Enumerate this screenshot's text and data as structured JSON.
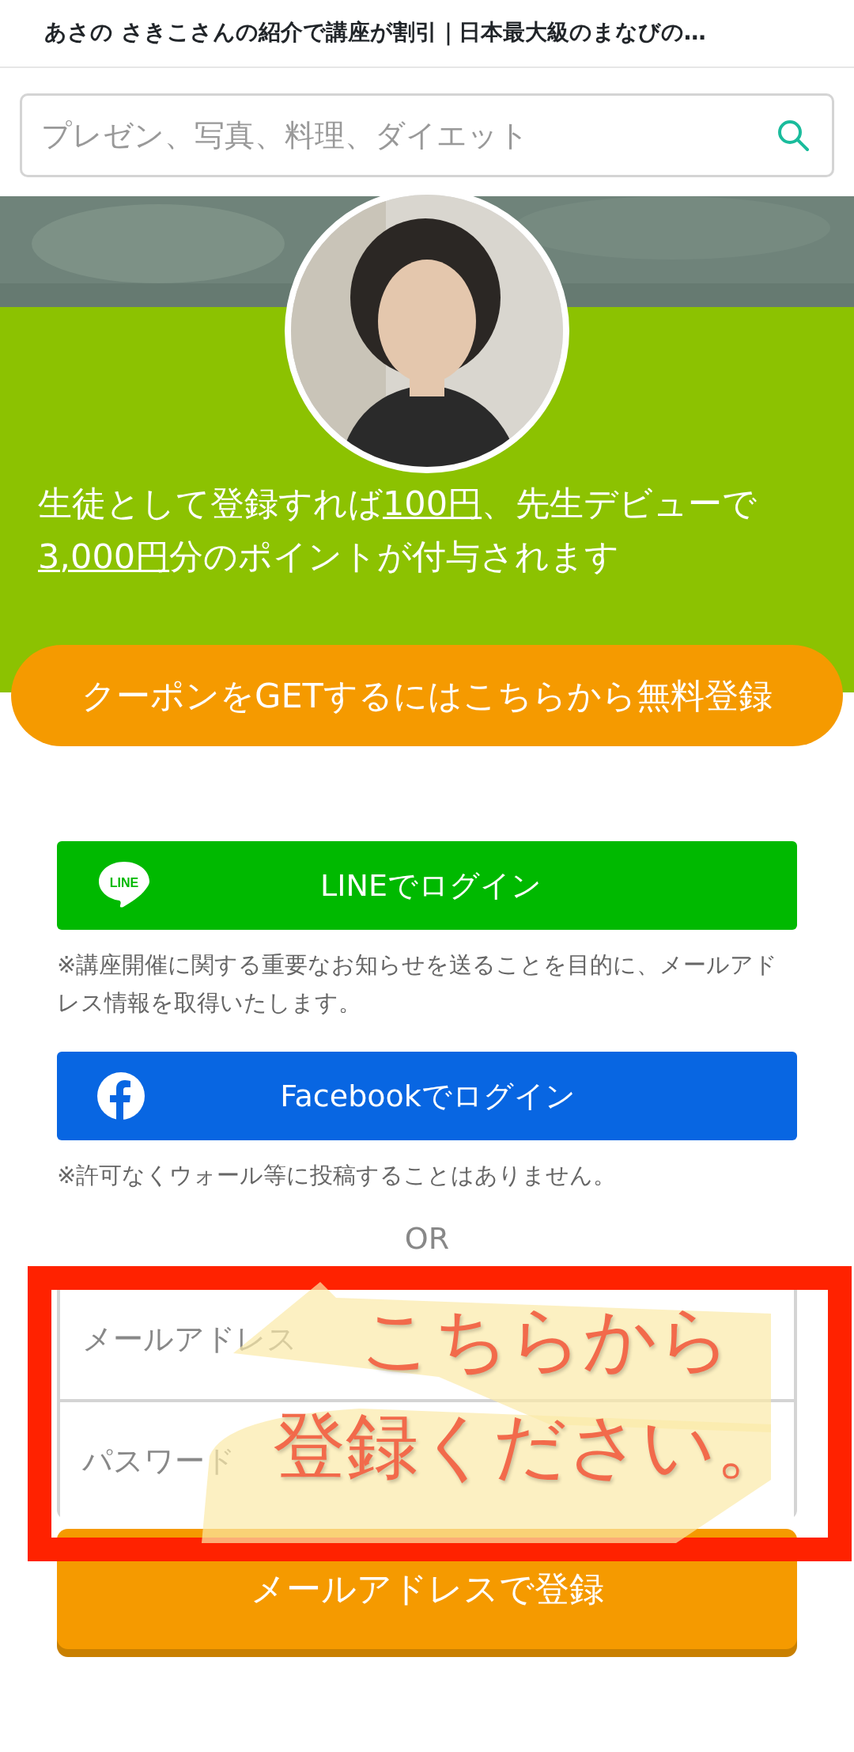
{
  "page_title": "あさの さきこさんの紹介で講座が割引｜日本最大級のまなびの…",
  "search": {
    "placeholder": "プレゼン、写真、料理、ダイエット"
  },
  "points_text": [
    {
      "text": "生徒として登録すれば",
      "underline": false
    },
    {
      "text": "100円",
      "underline": true
    },
    {
      "text": "、先生デビューで",
      "underline": false
    },
    {
      "text": "3,000円",
      "underline": true
    },
    {
      "text": "分のポイントが付与されます",
      "underline": false
    }
  ],
  "coupon_button": "クーポンをGETするにはこちらから無料登録",
  "social_logins": [
    {
      "kind": "line",
      "icon_text": "LINE",
      "label": "LINEでログイン",
      "note": "※講座開催に関する重要なお知らせを送ることを目的に、メールアドレス情報を取得いたします。"
    },
    {
      "kind": "facebook",
      "label": "Facebookでログイン",
      "note": "※許可なくウォール等に投稿することはありません。"
    }
  ],
  "separator": "OR",
  "form": {
    "fields": [
      {
        "placeholder": "メールアドレス"
      },
      {
        "placeholder": "パスワード"
      }
    ],
    "submit": "メールアドレスで登録"
  },
  "annotation": {
    "lines": [
      "こちらから",
      "登録ください。"
    ]
  }
}
